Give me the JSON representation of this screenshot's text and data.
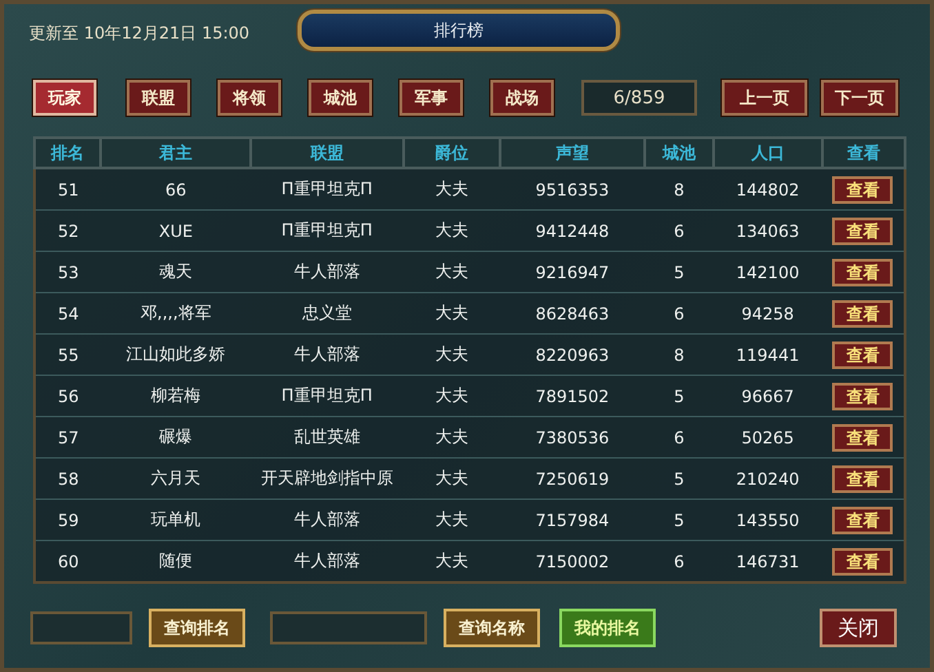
{
  "updated": "更新至 10年12月21日 15:00",
  "title": "排行榜",
  "tabs": [
    {
      "label": "玩家",
      "selected": true
    },
    {
      "label": "联盟",
      "selected": false
    },
    {
      "label": "将领",
      "selected": false
    },
    {
      "label": "城池",
      "selected": false
    },
    {
      "label": "军事",
      "selected": false
    },
    {
      "label": "战场",
      "selected": false
    }
  ],
  "page": "6/859",
  "pager": [
    "上一页",
    "下一页"
  ],
  "table": {
    "columns": [
      "排名",
      "君主",
      "联盟",
      "爵位",
      "声望",
      "城池",
      "人口",
      "查看"
    ],
    "rows": [
      [
        "51",
        "66",
        "Π重甲坦克Π",
        "大夫",
        "9516353",
        "8",
        "144802",
        "查看"
      ],
      [
        "52",
        "XUE",
        "Π重甲坦克Π",
        "大夫",
        "9412448",
        "6",
        "134063",
        "查看"
      ],
      [
        "53",
        "魂天",
        "牛人部落",
        "大夫",
        "9216947",
        "5",
        "142100",
        "查看"
      ],
      [
        "54",
        "邓,,,,将军",
        "忠义堂",
        "大夫",
        "8628463",
        "6",
        "94258",
        "查看"
      ],
      [
        "55",
        "江山如此多娇",
        "牛人部落",
        "大夫",
        "8220963",
        "8",
        "119441",
        "查看"
      ],
      [
        "56",
        "柳若梅",
        "Π重甲坦克Π",
        "大夫",
        "7891502",
        "5",
        "96667",
        "查看"
      ],
      [
        "57",
        "碾爆",
        "乱世英雄",
        "大夫",
        "7380536",
        "6",
        "50265",
        "查看"
      ],
      [
        "58",
        "六月天",
        "开天辟地剑指中原",
        "大夫",
        "7250619",
        "5",
        "210240",
        "查看"
      ],
      [
        "59",
        "玩单机",
        "牛人部落",
        "大夫",
        "7157984",
        "5",
        "143550",
        "查看"
      ],
      [
        "60",
        "随便",
        "牛人部落",
        "大夫",
        "7150002",
        "6",
        "146731",
        "查看"
      ]
    ]
  },
  "footer": [
    {
      "kind": "field"
    },
    {
      "kind": "button",
      "label": "查询排名"
    },
    {
      "kind": "widefield"
    },
    {
      "kind": "button",
      "label": "查询名称"
    },
    {
      "kind": "greenbutton",
      "label": "我的排名"
    }
  ],
  "close": "关闭"
}
